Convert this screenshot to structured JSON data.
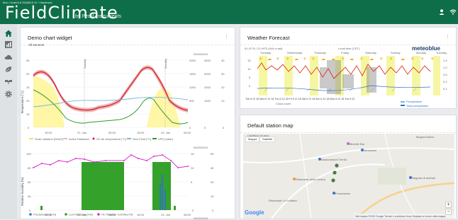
{
  "app": {
    "build": "Mon / build 6.8.3018815 12 / Hardened",
    "logo": "FieldClimate",
    "logo_sub": "by Pessl Instruments"
  },
  "demo_widget": {
    "title": "Demo chart widget",
    "sensors_label": "All sensors",
    "date_top": "03/20/2019",
    "date_mid": "03/20/2019",
    "date_bottom": "03/20/2019",
    "legend1": [
      "Solar radiation [W/m2]",
      "Active Radiation",
      "HC Air temperature [°C]",
      "Dew Point [°C]",
      "VPD [mbar]"
    ],
    "legend2": [
      "Precipitation [mm]",
      "Leaf Wetness [min]",
      "HC Relative humidity [%]"
    ],
    "xticks": [
      "18:00",
      "22. Jan",
      "06:00",
      "18:00",
      "23. Jan",
      "06:00"
    ],
    "x_label_top": "Sunday",
    "x_label_bottom": "Monday",
    "left_axis_label_1": "Temperature [°C]",
    "left_axis_label_2": "Relative humidity [%]"
  },
  "weather": {
    "title": "Weather Forecast",
    "brand": "meteoblue",
    "coords": "61.21°N / 21.94°E (444 m asl)",
    "local_time": "Local time (CET)",
    "days": [
      "Tuesday",
      "Wednesday",
      "Thursday",
      "Friday",
      "Saturday",
      "Sunday",
      "Monday",
      "Tuesday"
    ],
    "xaxis": "Tue 6 12 18 Wed 6 12 18 Thu 6 12 18 Fri 6 12 18 Sat 6 12 18 Sun 6 12 18 Mon 6 12 18 Tue 6 12",
    "legend_precip": "Precipitation",
    "legend_total": "Total precipitation",
    "legend_cloud": "Cloud cover"
  },
  "map": {
    "title": "Default station map",
    "btn_map": "Mappa",
    "btn_sat": "Satellite",
    "places": [
      "Mugna Kulera",
      "Calzificio Gruppo",
      "Michele Bar",
      "Alimentari",
      "Assicurazioni Trento",
      "Ristorante della Contea",
      "Ferramenta",
      "Negozio di animali",
      "Ristorante La Fontana"
    ],
    "google": "Google",
    "footer": "Dati mappa ©2019 Google   Termini e condizioni d'uso   Segnala un errore nella mappa"
  },
  "chart_data": [
    {
      "type": "line",
      "title": "",
      "x": [
        "18:00",
        "22. Jan",
        "06:00",
        "18:00",
        "23. Jan",
        "06:00"
      ],
      "ylim": [
        0,
        35
      ],
      "series": [
        {
          "name": "HC Air temperature [°C]",
          "values": [
            28,
            30,
            21,
            12,
            10,
            11,
            14,
            26,
            30,
            26,
            14,
            9
          ]
        },
        {
          "name": "Dew Point [°C]",
          "values": [
            8,
            9,
            12,
            14,
            15,
            15,
            12,
            8,
            7,
            9,
            13,
            14
          ]
        },
        {
          "name": "Solar radiation [W/m2]",
          "values": [
            1700,
            1600,
            1200,
            0,
            0,
            0,
            0,
            900,
            1500,
            800,
            0,
            0
          ]
        }
      ]
    },
    {
      "type": "bar",
      "title": "",
      "ylim": [
        0,
        100
      ],
      "series": [
        {
          "name": "HC Relative humidity [%]",
          "values": [
            80,
            85,
            75,
            70,
            78,
            88,
            90,
            92,
            95,
            93,
            70,
            60,
            85,
            90
          ]
        },
        {
          "name": "Leaf Wetness [min]",
          "values": [
            0,
            0,
            0,
            0,
            60,
            60,
            60,
            0,
            0,
            60,
            60,
            0,
            0,
            0
          ]
        }
      ]
    }
  ]
}
